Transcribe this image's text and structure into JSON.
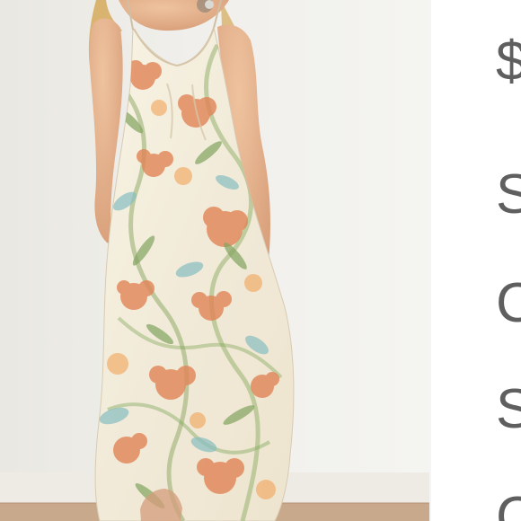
{
  "cropped_text_panel": {
    "lines": [
      "$",
      "S",
      "C",
      "S",
      "C"
    ],
    "text_color": "#5f5f5f"
  },
  "photo": {
    "colors": {
      "background": "#efefeb",
      "skin": "#e5b38e",
      "hair": "#d6ad63",
      "dress": "#f4efdf",
      "floral_orange": "#e2844f",
      "floral_green": "#8aa75b",
      "floral_blue": "#8bbec2",
      "floor": "#c9a98c"
    }
  }
}
